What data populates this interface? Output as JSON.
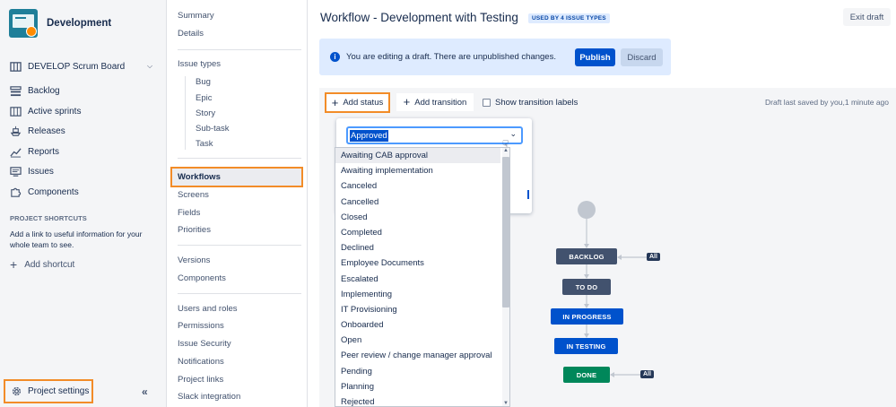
{
  "project": {
    "name": "Development"
  },
  "sidebar": {
    "board": "DEVELOP Scrum Board",
    "items": [
      {
        "label": "Backlog"
      },
      {
        "label": "Active sprints"
      },
      {
        "label": "Releases"
      },
      {
        "label": "Reports"
      },
      {
        "label": "Issues"
      },
      {
        "label": "Components"
      }
    ],
    "shortcuts_title": "PROJECT SHORTCUTS",
    "shortcuts_desc": "Add a link to useful information for your whole team to see.",
    "add_shortcut": "Add shortcut",
    "project_settings": "Project settings",
    "collapse": "«"
  },
  "settings_nav": {
    "summary": "Summary",
    "details": "Details",
    "issue_types": "Issue types",
    "issue_type_items": [
      "Bug",
      "Epic",
      "Story",
      "Sub-task",
      "Task"
    ],
    "workflows": "Workflows",
    "screens": "Screens",
    "fields": "Fields",
    "priorities": "Priorities",
    "versions": "Versions",
    "components": "Components",
    "users_roles": "Users and roles",
    "permissions": "Permissions",
    "issue_security": "Issue Security",
    "notifications": "Notifications",
    "project_links": "Project links",
    "slack": "Slack integration"
  },
  "header": {
    "title": "Workflow - Development with Testing",
    "used_by": "USED BY 4 ISSUE TYPES",
    "exit_draft": "Exit draft"
  },
  "banner": {
    "message": "You are editing a draft. There are unpublished changes.",
    "publish": "Publish",
    "discard": "Discard"
  },
  "toolbar": {
    "add_status": "Add status",
    "add_transition": "Add transition",
    "show_labels": "Show transition labels",
    "saved_note": "Draft last saved by you,1 minute ago"
  },
  "status_select": {
    "selected": "Approved",
    "options": [
      "Awaiting CAB approval",
      "Awaiting implementation",
      "Canceled",
      "Cancelled",
      "Closed",
      "Completed",
      "Declined",
      "Employee Documents",
      "Escalated",
      "Implementing",
      "IT Provisioning",
      "Onboarded",
      "Open",
      "Peer review / change manager approval",
      "Pending",
      "Planning",
      "Rejected"
    ]
  },
  "diagram": {
    "nodes": [
      {
        "label": "BACKLOG",
        "color": "#42526e"
      },
      {
        "label": "TO DO",
        "color": "#42526e"
      },
      {
        "label": "IN PROGRESS",
        "color": "#0052cc"
      },
      {
        "label": "IN TESTING",
        "color": "#0052cc"
      },
      {
        "label": "DONE",
        "color": "#00875a"
      }
    ],
    "all_label": "All"
  }
}
